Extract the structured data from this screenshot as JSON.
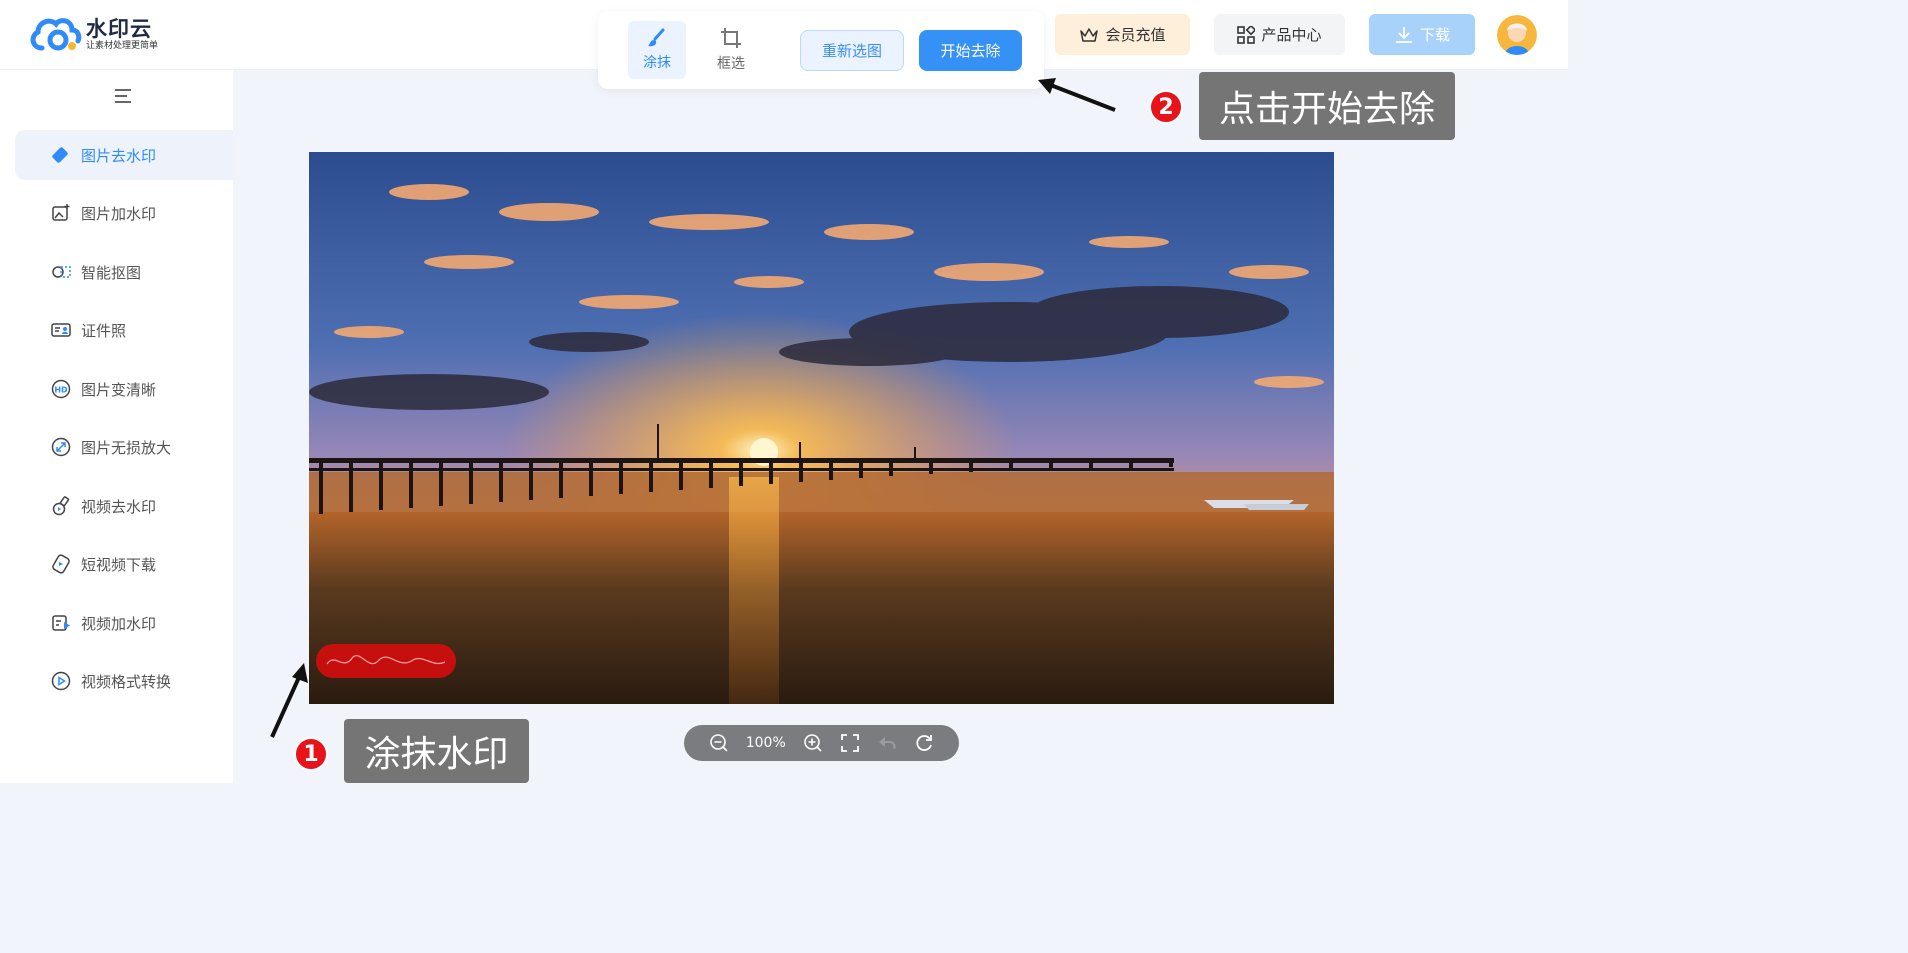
{
  "logo": {
    "title": "水印云",
    "subtitle": "让素材处理更简单"
  },
  "toolbar": {
    "tool_smear": "涂抹",
    "tool_box": "框选",
    "reselect_label": "重新选图",
    "start_label": "开始去除"
  },
  "header": {
    "vip_label": "会员充值",
    "product_label": "产品中心",
    "download_label": "下载"
  },
  "sidebar": {
    "items": [
      {
        "label": "图片去水印",
        "icon": "eraser-icon"
      },
      {
        "label": "图片加水印",
        "icon": "image-add-icon"
      },
      {
        "label": "智能抠图",
        "icon": "cutout-icon"
      },
      {
        "label": "证件照",
        "icon": "id-card-icon"
      },
      {
        "label": "图片变清晰",
        "icon": "hd-icon"
      },
      {
        "label": "图片无损放大",
        "icon": "expand-icon"
      },
      {
        "label": "视频去水印",
        "icon": "video-eraser-icon"
      },
      {
        "label": "短视频下载",
        "icon": "short-video-icon"
      },
      {
        "label": "视频加水印",
        "icon": "video-add-icon"
      },
      {
        "label": "视频格式转换",
        "icon": "video-convert-icon"
      }
    ]
  },
  "canvas": {
    "zoom": "100%"
  },
  "annotations": {
    "step1_num": "1",
    "step1_text": "涂抹水印",
    "step2_num": "2",
    "step2_text": "点击开始去除"
  },
  "colors": {
    "accent": "#3591f6",
    "marker_red": "#e8131a"
  }
}
